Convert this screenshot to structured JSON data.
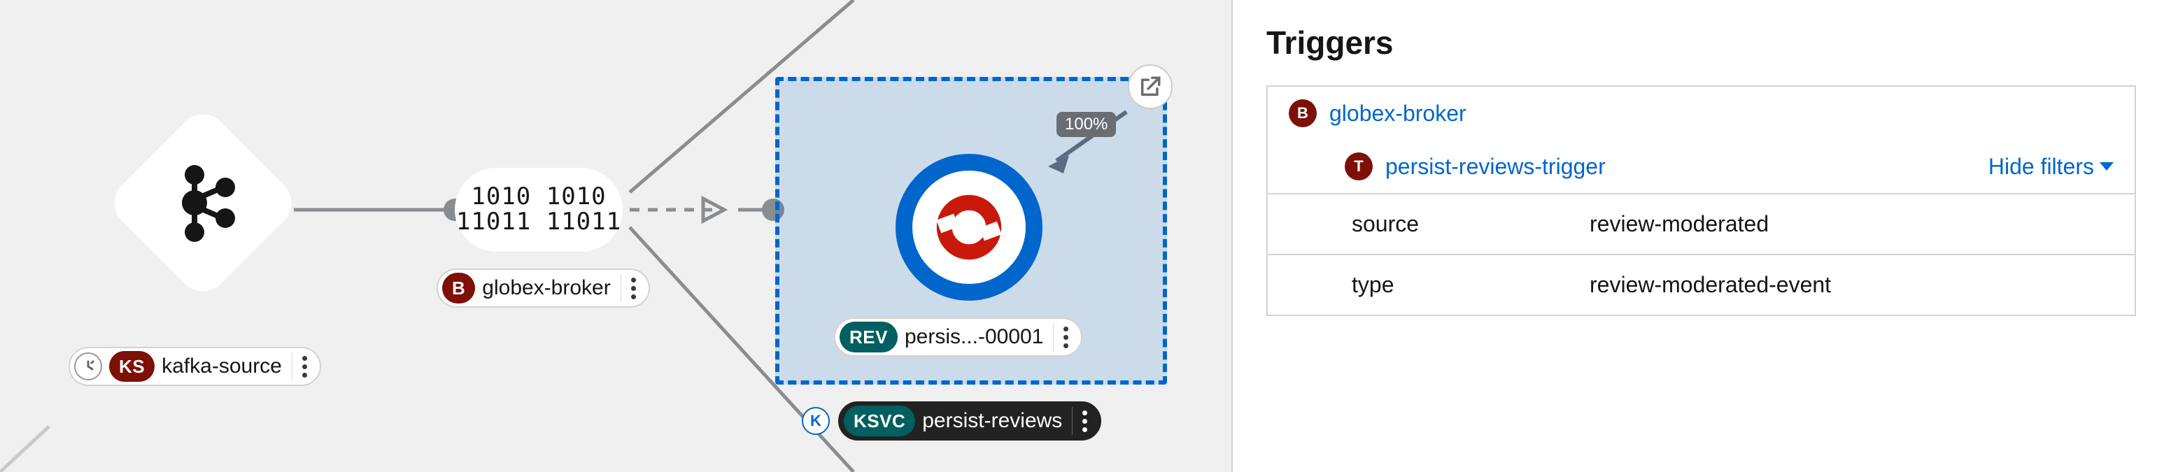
{
  "topology": {
    "kafka_source": {
      "badge": "KS",
      "label": "kafka-source"
    },
    "broker": {
      "badge": "B",
      "label": "globex-broker",
      "glyph_top": "1010 1010",
      "glyph_bot": "11011 11011"
    },
    "revision": {
      "badge": "REV",
      "label": "persis...-00001",
      "traffic_pct": "100%"
    },
    "service": {
      "badge": "KSVC",
      "label": "persist-reviews"
    }
  },
  "panel": {
    "title": "Triggers",
    "broker_badge": "B",
    "broker_name": "globex-broker",
    "trigger_badge": "T",
    "trigger_name": "persist-reviews-trigger",
    "hide_filters": "Hide filters",
    "filters": [
      {
        "key": "source",
        "value": "review-moderated"
      },
      {
        "key": "type",
        "value": "review-moderated-event"
      }
    ]
  }
}
